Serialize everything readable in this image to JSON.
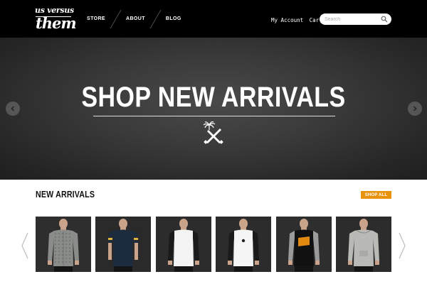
{
  "brand": {
    "logo_line1": "us versus",
    "logo_line2": "them"
  },
  "nav": {
    "items": [
      "STORE",
      "ABOUT",
      "BLOG"
    ]
  },
  "account": {
    "my_account": "My Account",
    "cart": "Cart"
  },
  "search": {
    "placeholder": "Search"
  },
  "hero": {
    "title": "SHOP NEW ARRIVALS"
  },
  "arrivals": {
    "title": "NEW ARRIVALS",
    "shop_all": "SHOP ALL",
    "accent": "#e8920e",
    "products": [
      {
        "name": "patterned button-up shirt",
        "bg": "#2e2e2e",
        "shirt": "#8a8c8a",
        "sleeves": "long"
      },
      {
        "name": "navy tee with striped sleeves",
        "bg": "#2a2a2a",
        "shirt": "#1c2b3e",
        "sleeves": "short"
      },
      {
        "name": "black and white raglan",
        "bg": "#2c2c2c",
        "shirt": "#f3f3f3",
        "sleeves": "raglan"
      },
      {
        "name": "white raglan with emblem",
        "bg": "#2c2c2c",
        "shirt": "#f5f5f5",
        "sleeves": "raglan"
      },
      {
        "name": "black raglan with orange logo",
        "bg": "#2e2e2e",
        "shirt": "#111111",
        "sleeves": "raglan"
      },
      {
        "name": "grey hoodie",
        "bg": "#2c2c2c",
        "shirt": "#b9b9b6",
        "sleeves": "long"
      }
    ]
  }
}
